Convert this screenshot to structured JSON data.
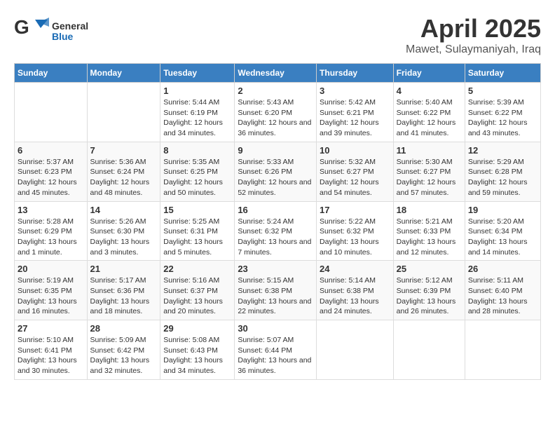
{
  "header": {
    "logo_general": "General",
    "logo_blue": "Blue",
    "main_title": "April 2025",
    "subtitle": "Mawet, Sulaymaniyah, Iraq"
  },
  "calendar": {
    "days": [
      "Sunday",
      "Monday",
      "Tuesday",
      "Wednesday",
      "Thursday",
      "Friday",
      "Saturday"
    ],
    "weeks": [
      [
        {
          "date": "",
          "sunrise": "",
          "sunset": "",
          "daylight": ""
        },
        {
          "date": "",
          "sunrise": "",
          "sunset": "",
          "daylight": ""
        },
        {
          "date": "1",
          "sunrise": "Sunrise: 5:44 AM",
          "sunset": "Sunset: 6:19 PM",
          "daylight": "Daylight: 12 hours and 34 minutes."
        },
        {
          "date": "2",
          "sunrise": "Sunrise: 5:43 AM",
          "sunset": "Sunset: 6:20 PM",
          "daylight": "Daylight: 12 hours and 36 minutes."
        },
        {
          "date": "3",
          "sunrise": "Sunrise: 5:42 AM",
          "sunset": "Sunset: 6:21 PM",
          "daylight": "Daylight: 12 hours and 39 minutes."
        },
        {
          "date": "4",
          "sunrise": "Sunrise: 5:40 AM",
          "sunset": "Sunset: 6:22 PM",
          "daylight": "Daylight: 12 hours and 41 minutes."
        },
        {
          "date": "5",
          "sunrise": "Sunrise: 5:39 AM",
          "sunset": "Sunset: 6:22 PM",
          "daylight": "Daylight: 12 hours and 43 minutes."
        }
      ],
      [
        {
          "date": "6",
          "sunrise": "Sunrise: 5:37 AM",
          "sunset": "Sunset: 6:23 PM",
          "daylight": "Daylight: 12 hours and 45 minutes."
        },
        {
          "date": "7",
          "sunrise": "Sunrise: 5:36 AM",
          "sunset": "Sunset: 6:24 PM",
          "daylight": "Daylight: 12 hours and 48 minutes."
        },
        {
          "date": "8",
          "sunrise": "Sunrise: 5:35 AM",
          "sunset": "Sunset: 6:25 PM",
          "daylight": "Daylight: 12 hours and 50 minutes."
        },
        {
          "date": "9",
          "sunrise": "Sunrise: 5:33 AM",
          "sunset": "Sunset: 6:26 PM",
          "daylight": "Daylight: 12 hours and 52 minutes."
        },
        {
          "date": "10",
          "sunrise": "Sunrise: 5:32 AM",
          "sunset": "Sunset: 6:27 PM",
          "daylight": "Daylight: 12 hours and 54 minutes."
        },
        {
          "date": "11",
          "sunrise": "Sunrise: 5:30 AM",
          "sunset": "Sunset: 6:27 PM",
          "daylight": "Daylight: 12 hours and 57 minutes."
        },
        {
          "date": "12",
          "sunrise": "Sunrise: 5:29 AM",
          "sunset": "Sunset: 6:28 PM",
          "daylight": "Daylight: 12 hours and 59 minutes."
        }
      ],
      [
        {
          "date": "13",
          "sunrise": "Sunrise: 5:28 AM",
          "sunset": "Sunset: 6:29 PM",
          "daylight": "Daylight: 13 hours and 1 minute."
        },
        {
          "date": "14",
          "sunrise": "Sunrise: 5:26 AM",
          "sunset": "Sunset: 6:30 PM",
          "daylight": "Daylight: 13 hours and 3 minutes."
        },
        {
          "date": "15",
          "sunrise": "Sunrise: 5:25 AM",
          "sunset": "Sunset: 6:31 PM",
          "daylight": "Daylight: 13 hours and 5 minutes."
        },
        {
          "date": "16",
          "sunrise": "Sunrise: 5:24 AM",
          "sunset": "Sunset: 6:32 PM",
          "daylight": "Daylight: 13 hours and 7 minutes."
        },
        {
          "date": "17",
          "sunrise": "Sunrise: 5:22 AM",
          "sunset": "Sunset: 6:32 PM",
          "daylight": "Daylight: 13 hours and 10 minutes."
        },
        {
          "date": "18",
          "sunrise": "Sunrise: 5:21 AM",
          "sunset": "Sunset: 6:33 PM",
          "daylight": "Daylight: 13 hours and 12 minutes."
        },
        {
          "date": "19",
          "sunrise": "Sunrise: 5:20 AM",
          "sunset": "Sunset: 6:34 PM",
          "daylight": "Daylight: 13 hours and 14 minutes."
        }
      ],
      [
        {
          "date": "20",
          "sunrise": "Sunrise: 5:19 AM",
          "sunset": "Sunset: 6:35 PM",
          "daylight": "Daylight: 13 hours and 16 minutes."
        },
        {
          "date": "21",
          "sunrise": "Sunrise: 5:17 AM",
          "sunset": "Sunset: 6:36 PM",
          "daylight": "Daylight: 13 hours and 18 minutes."
        },
        {
          "date": "22",
          "sunrise": "Sunrise: 5:16 AM",
          "sunset": "Sunset: 6:37 PM",
          "daylight": "Daylight: 13 hours and 20 minutes."
        },
        {
          "date": "23",
          "sunrise": "Sunrise: 5:15 AM",
          "sunset": "Sunset: 6:38 PM",
          "daylight": "Daylight: 13 hours and 22 minutes."
        },
        {
          "date": "24",
          "sunrise": "Sunrise: 5:14 AM",
          "sunset": "Sunset: 6:38 PM",
          "daylight": "Daylight: 13 hours and 24 minutes."
        },
        {
          "date": "25",
          "sunrise": "Sunrise: 5:12 AM",
          "sunset": "Sunset: 6:39 PM",
          "daylight": "Daylight: 13 hours and 26 minutes."
        },
        {
          "date": "26",
          "sunrise": "Sunrise: 5:11 AM",
          "sunset": "Sunset: 6:40 PM",
          "daylight": "Daylight: 13 hours and 28 minutes."
        }
      ],
      [
        {
          "date": "27",
          "sunrise": "Sunrise: 5:10 AM",
          "sunset": "Sunset: 6:41 PM",
          "daylight": "Daylight: 13 hours and 30 minutes."
        },
        {
          "date": "28",
          "sunrise": "Sunrise: 5:09 AM",
          "sunset": "Sunset: 6:42 PM",
          "daylight": "Daylight: 13 hours and 32 minutes."
        },
        {
          "date": "29",
          "sunrise": "Sunrise: 5:08 AM",
          "sunset": "Sunset: 6:43 PM",
          "daylight": "Daylight: 13 hours and 34 minutes."
        },
        {
          "date": "30",
          "sunrise": "Sunrise: 5:07 AM",
          "sunset": "Sunset: 6:44 PM",
          "daylight": "Daylight: 13 hours and 36 minutes."
        },
        {
          "date": "",
          "sunrise": "",
          "sunset": "",
          "daylight": ""
        },
        {
          "date": "",
          "sunrise": "",
          "sunset": "",
          "daylight": ""
        },
        {
          "date": "",
          "sunrise": "",
          "sunset": "",
          "daylight": ""
        }
      ]
    ]
  }
}
